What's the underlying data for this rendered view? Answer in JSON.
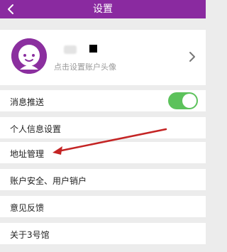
{
  "header": {
    "title": "设置"
  },
  "profile": {
    "hint": "点击设置账户头像"
  },
  "settings": [
    {
      "label": "消息推送",
      "toggle": true
    },
    {
      "label": "个人信息设置"
    },
    {
      "label": "地址管理"
    },
    {
      "label": "账户安全、用户销户"
    },
    {
      "label": "意见反馈"
    },
    {
      "label": "关于3号馆"
    }
  ],
  "colors": {
    "header": "#8a2aa0",
    "toggle_on": "#5cc25b",
    "annotation_arrow": "#c42424"
  },
  "icons": [
    "back-arrow-icon",
    "chevron-right-icon",
    "avatar-icon"
  ]
}
